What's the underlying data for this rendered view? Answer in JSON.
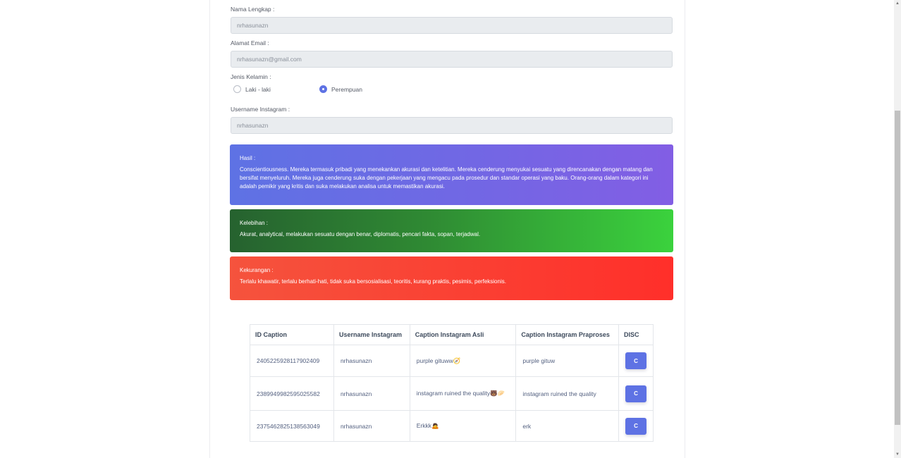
{
  "form": {
    "nama_label": "Nama Lengkap :",
    "nama_value": "nrhasunazn",
    "email_label": "Alamat Email :",
    "email_value": "nrhasunazn@gmail.com",
    "kelamin_label": "Jenis Kelamin :",
    "radio_laki": "Laki - laki",
    "radio_perempuan": "Perempuan",
    "instagram_label": "Username Instagram :",
    "instagram_value": "nrhasunazn"
  },
  "hasil": {
    "title": "Hasil :",
    "text": "Conscientiousness. Mereka termasuk pribadi yang menekankan akurasi dan ketelitian. Mereka cenderung menyukai sesuatu yang direncanakan dengan matang dan bersifat menyeluruh. Mereka juga cenderung suka dengan pekerjaan yang mengacu pada prosedur dan standar operasi yang baku. Orang-orang dalam kategori ini adalah pemikir yang kritis dan suka melakukan analisa untuk memastikan akurasi."
  },
  "kelebihan": {
    "title": "Kelebihan :",
    "text": "Akurat, analytical, melakukan sesuatu dengan benar, diplomatis, pencari fakta, sopan, terjadwal."
  },
  "kekurangan": {
    "title": "Kekurangan :",
    "text": "Terlalu khawatir, terlalu berhati-hati, tidak suka bersosialisasi, teoritis, kurang praktis, pesimis, perfeksionis."
  },
  "table": {
    "headers": [
      "ID Caption",
      "Username Instagram",
      "Caption Instagram Asli",
      "Caption Instagram Praproses",
      "DISC"
    ],
    "rows": [
      {
        "id": "2405225928117902409",
        "username": "nrhasunazn",
        "caption": "purple gituww🧭",
        "praproses": "purple gituw",
        "disc": "C"
      },
      {
        "id": "2389949982595025582",
        "username": "nrhasunazn",
        "caption": "instagram ruined the quality🐻🥟",
        "praproses": "instagram ruined the quality",
        "disc": "C"
      },
      {
        "id": "2375462825138563049",
        "username": "nrhasunazn",
        "caption": "Erkkk🙇",
        "praproses": "erk",
        "disc": "C"
      }
    ]
  },
  "colors": {
    "primary": "#5e72e4",
    "success": "#2dce89",
    "danger": "#f5365c"
  }
}
